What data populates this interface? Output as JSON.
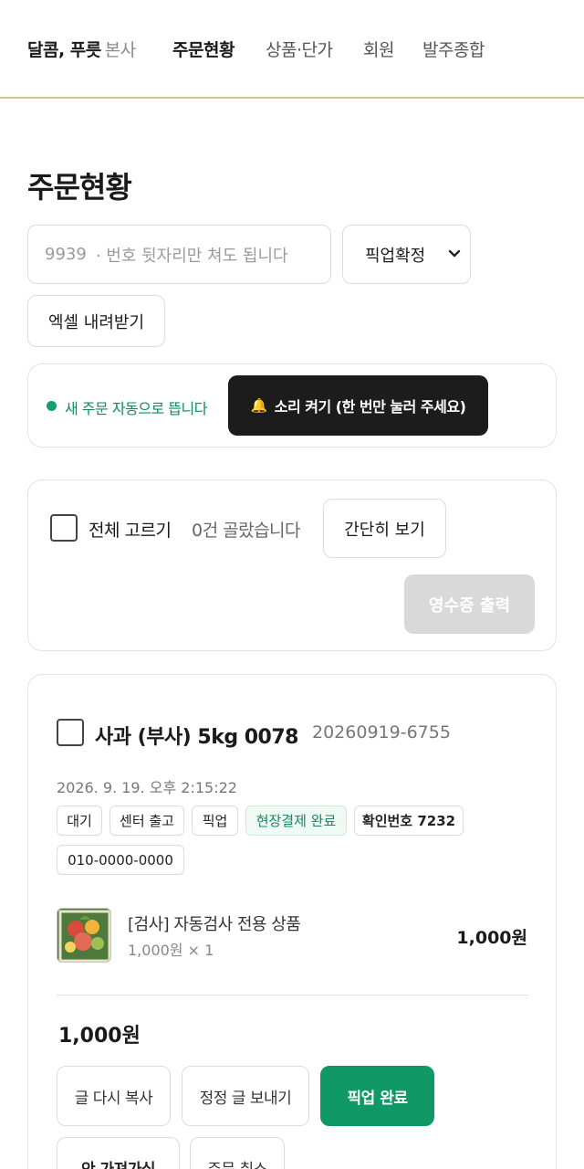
{
  "header": {
    "brand": "달콤, 푸릇",
    "brand_sub": "본사",
    "nav": [
      "주문현황",
      "상품·단가",
      "회원",
      "발주종합"
    ]
  },
  "page": {
    "title": "주문현황"
  },
  "filters": {
    "search_value": "9939",
    "search_placeholder": "· 번호 뒷자리만 쳐도 됩니다",
    "status_selected": "픽업확정",
    "excel_label": "엑셀 내려받기"
  },
  "notice": {
    "live_text": "새 주문 자동으로 뜹니다",
    "sound_label": "소리 켜기 (한 번만 눌러 주세요)",
    "bell_icon": "bell-icon",
    "accent": "#12a06b"
  },
  "selection": {
    "select_all_label": "전체 고르기",
    "count_text": "0건 골랐습니다",
    "simple_view_label": "간단히 보기",
    "receipt_label": "영수증 출력"
  },
  "order": {
    "title": "사과 (부사) 5kg 0078",
    "order_number": "20260919-6755",
    "time": "2026. 9. 19. 오후 2:15:22",
    "tags": [
      "대기",
      "센터 출고",
      "픽업",
      "현장결제 완료",
      "확인번호 7232",
      "010-0000-0000"
    ],
    "item": {
      "name": "[검사] 자동검사 전용 상품",
      "qty_text": "1,000원 × 1",
      "price": "1,000원"
    },
    "total": "1,000원",
    "actions": [
      "글 다시 복사",
      "정정 글 보내기",
      "픽업 완료",
      "안 가져가심",
      "주문 취소"
    ],
    "primary_color": "#109866"
  }
}
